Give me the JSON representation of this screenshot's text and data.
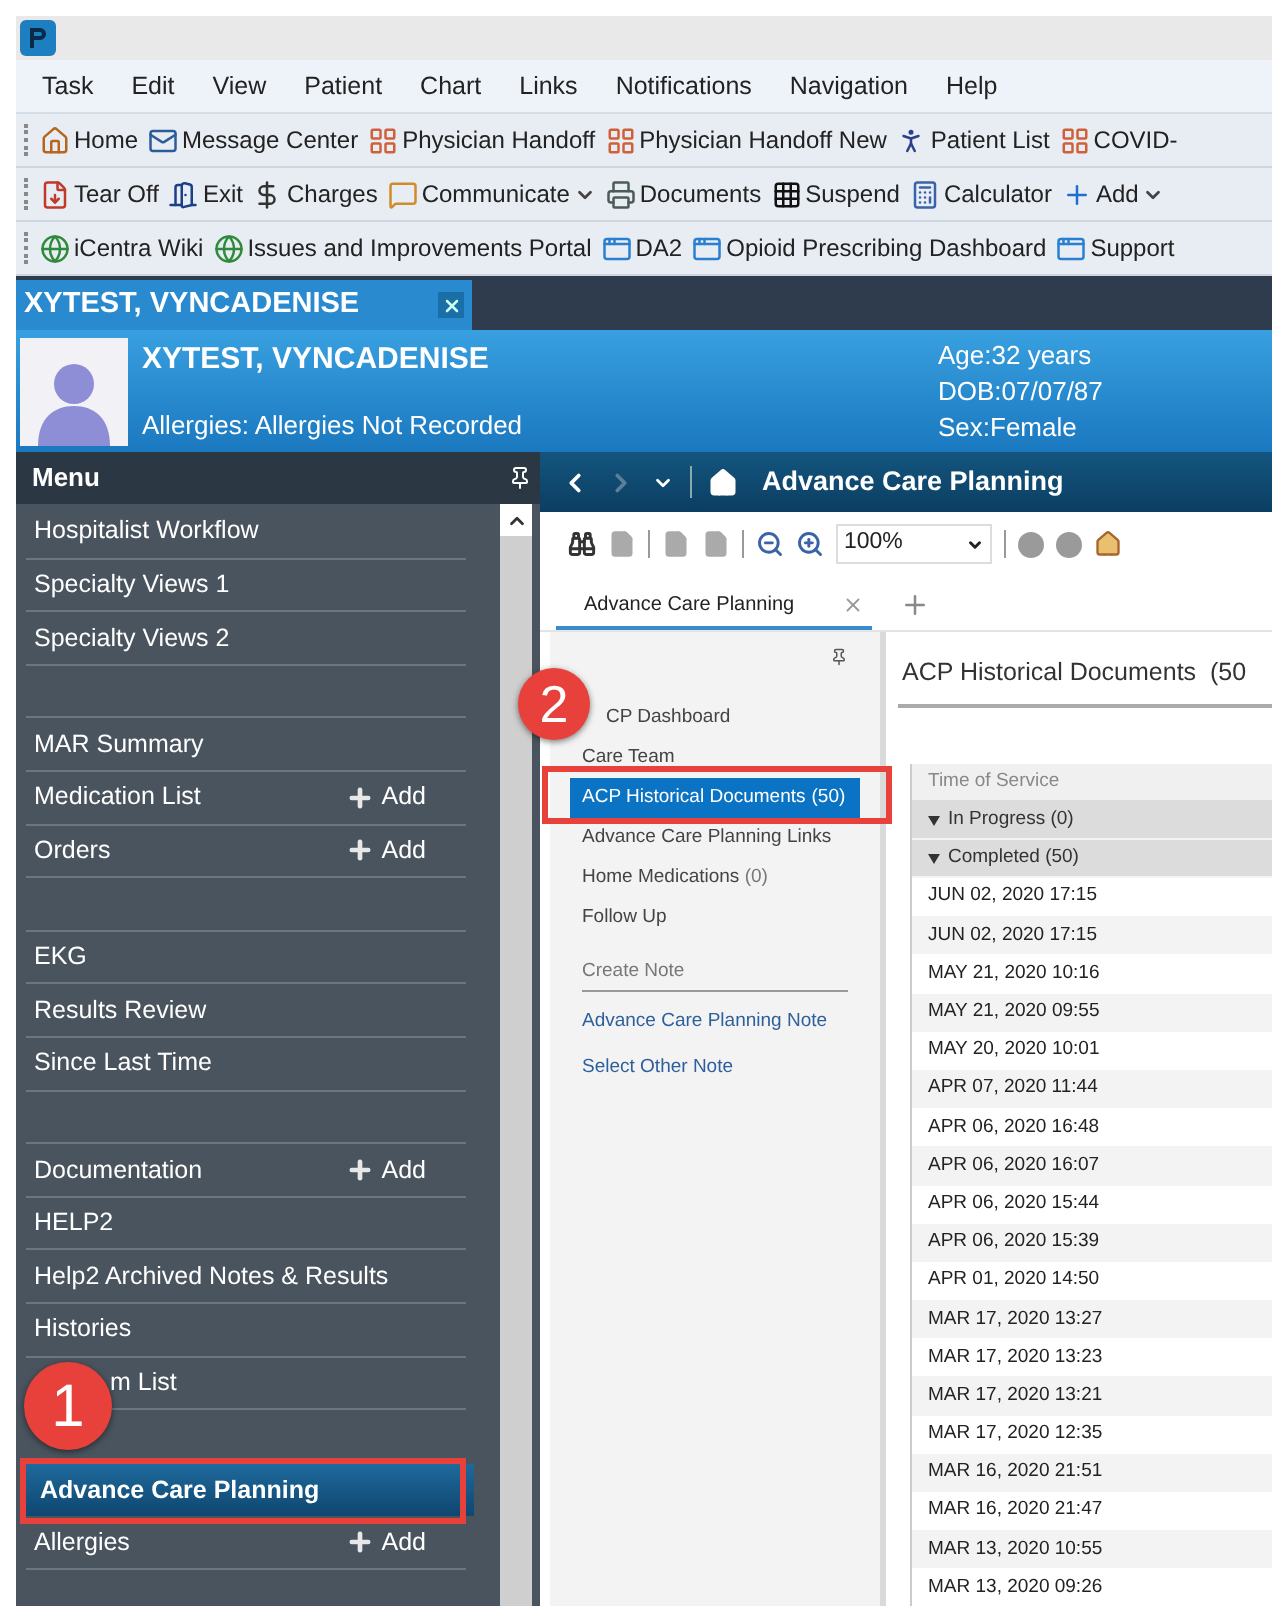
{
  "menu_bar": [
    "Task",
    "Edit",
    "View",
    "Patient",
    "Chart",
    "Links",
    "Notifications",
    "Navigation",
    "Help"
  ],
  "toolbars": [
    {
      "items": [
        {
          "label": "Home",
          "dropdown": false
        },
        {
          "label": "Message Center",
          "dropdown": false
        },
        {
          "label": "Physician Handoff",
          "dropdown": false
        },
        {
          "label": "Physician Handoff New",
          "dropdown": false
        },
        {
          "label": "Patient List",
          "dropdown": false
        },
        {
          "label": "COVID-",
          "dropdown": false
        }
      ]
    },
    {
      "items": [
        {
          "label": "Tear Off",
          "dropdown": false
        },
        {
          "label": "Exit",
          "dropdown": false
        },
        {
          "label": "Charges",
          "dropdown": false
        },
        {
          "label": "Communicate",
          "dropdown": true
        },
        {
          "label": "Documents",
          "dropdown": false
        },
        {
          "label": "Suspend",
          "dropdown": false
        },
        {
          "label": "Calculator",
          "dropdown": false
        },
        {
          "label": "Add",
          "dropdown": true
        }
      ]
    },
    {
      "items": [
        {
          "label": "iCentra Wiki",
          "dropdown": false
        },
        {
          "label": "Issues and Improvements Portal",
          "dropdown": false
        },
        {
          "label": "DA2",
          "dropdown": false
        },
        {
          "label": "Opioid Prescribing Dashboard",
          "dropdown": false
        },
        {
          "label": "Support",
          "dropdown": false
        }
      ]
    }
  ],
  "patient_tab": {
    "title": "XYTEST, VYNCADENISE"
  },
  "banner": {
    "name": "XYTEST, VYNCADENISE",
    "allergies": "Allergies: Allergies Not Recorded",
    "age": "Age:32 years",
    "dob": "DOB:07/07/87",
    "sex": "Sex:Female"
  },
  "menu": {
    "title": "Menu",
    "items": [
      {
        "kind": "item",
        "label": "Hospitalist Workflow",
        "selected": false
      },
      {
        "kind": "item",
        "label": "Specialty Views 1",
        "selected": false
      },
      {
        "kind": "item",
        "label": "Specialty Views 2",
        "selected": false
      },
      {
        "kind": "gap"
      },
      {
        "kind": "item",
        "label": "MAR Summary",
        "selected": false
      },
      {
        "kind": "item",
        "label": "Medication List",
        "add": "Add",
        "selected": false
      },
      {
        "kind": "item",
        "label": "Orders",
        "add": "Add",
        "selected": false
      },
      {
        "kind": "gap"
      },
      {
        "kind": "item",
        "label": "EKG",
        "selected": false
      },
      {
        "kind": "item",
        "label": "Results Review",
        "selected": false
      },
      {
        "kind": "item",
        "label": "Since Last Time",
        "selected": false
      },
      {
        "kind": "gap"
      },
      {
        "kind": "item",
        "label": "Documentation",
        "add": "Add",
        "selected": false
      },
      {
        "kind": "item",
        "label": "HELP2",
        "selected": false
      },
      {
        "kind": "item",
        "label": "Help2 Archived Notes & Results",
        "selected": false
      },
      {
        "kind": "item",
        "label": "Histories",
        "selected": false
      },
      {
        "kind": "partial",
        "label": "m List",
        "selected": false
      },
      {
        "kind": "gap"
      },
      {
        "kind": "item",
        "label": "Advance Care Planning",
        "selected": true
      },
      {
        "kind": "item",
        "label": "Allergies",
        "add": "Add",
        "selected": false
      }
    ]
  },
  "page": {
    "title": "Advance Care Planning",
    "zoom": "100%",
    "tabs": [
      {
        "label": "Advance Care Planning",
        "selected": true
      }
    ],
    "nav": [
      {
        "kind": "partial",
        "label": "CP Dashboard",
        "selected": false
      },
      {
        "kind": "item",
        "label": "Care Team",
        "selected": false
      },
      {
        "kind": "item",
        "label": "ACP Historical Documents",
        "count": "(50)",
        "selected": true
      },
      {
        "kind": "item",
        "label": "Advance Care Planning Links",
        "selected": false
      },
      {
        "kind": "item",
        "label": "Home Medications",
        "count": "(0)",
        "selected": false
      },
      {
        "kind": "item",
        "label": "Follow Up",
        "selected": false
      },
      {
        "kind": "section",
        "label": "Create Note"
      },
      {
        "kind": "link",
        "label": "Advance Care Planning Note"
      },
      {
        "kind": "link",
        "label": "Select Other Note"
      }
    ],
    "heading": "ACP Historical Documents  (50",
    "table": {
      "columns": [
        "Time of Service"
      ],
      "groups": [
        {
          "label": "In Progress (0)",
          "expanded": true
        },
        {
          "label": "Completed (50)",
          "expanded": true
        }
      ],
      "rows": [
        "JUN 02, 2020 17:15",
        "JUN 02, 2020 17:15",
        "MAY 21, 2020 10:16",
        "MAY 21, 2020 09:55",
        "MAY 20, 2020 10:01",
        "APR 07, 2020 11:44",
        "APR 06, 2020 16:48",
        "APR 06, 2020 16:07",
        "APR 06, 2020 15:44",
        "APR 06, 2020 15:39",
        "APR 01, 2020 14:50",
        "MAR 17, 2020 13:27",
        "MAR 17, 2020 13:23",
        "MAR 17, 2020 13:21",
        "MAR 17, 2020 12:35",
        "MAR 16, 2020 21:51",
        "MAR 16, 2020 21:47",
        "MAR 13, 2020 10:55",
        "MAR 13, 2020 09:26"
      ]
    }
  },
  "annotations": [
    {
      "label": "1"
    },
    {
      "label": "2"
    }
  ]
}
